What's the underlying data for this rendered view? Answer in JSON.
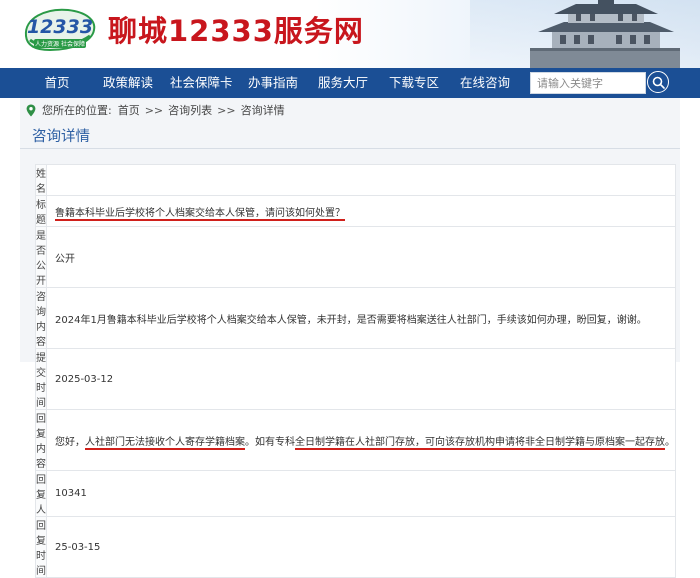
{
  "header": {
    "logo_number": "12333",
    "logo_tagline": "人力资源 社会保障",
    "site_title": "聊城12333服务网"
  },
  "nav": {
    "items": [
      "首页",
      "政策解读",
      "社会保障卡",
      "办事指南",
      "服务大厅",
      "下载专区",
      "在线咨询"
    ],
    "search_placeholder": "请输入关键字"
  },
  "breadcrumb": {
    "prefix": "您所在的位置:",
    "items": [
      "首页",
      "咨询列表",
      "咨询详情"
    ],
    "separator": ">>"
  },
  "section_title": "咨询详情",
  "detail": {
    "name_label": "姓名",
    "name_value": "",
    "title_label": "标题",
    "title_value": "鲁籍本科毕业后学校将个人档案交给本人保管，请问该如何处置？",
    "public_label": "是否公开",
    "public_value": "公开",
    "content_label": "咨询内容",
    "content_value": "2024年1月鲁籍本科毕业后学校将个人档案交给本人保管，未开封，是否需要将档案送往人社部门，手续该如何办理，盼回复，谢谢。",
    "submit_label": "提交时间",
    "submit_value": "2025-03-12",
    "reply_label": "回复内容",
    "reply_part1": "您好，",
    "reply_part2": "人社部门无法接收个人寄存学籍档案",
    "reply_part3": "。如有专科",
    "reply_part4": "全日制学籍在人社部门存放，可向该存放机构申请将非全日制学籍与原档案一起存放",
    "reply_part5": "。",
    "replier_label": "回复人",
    "replier_value": "10341",
    "reply_time_label": "回复时间",
    "reply_time_value": "25-03-15"
  },
  "colors": {
    "brand_red": "#c8161d",
    "nav_blue": "#1b4f95",
    "title_blue": "#2d5fa3",
    "underline_red": "#d0201b"
  }
}
